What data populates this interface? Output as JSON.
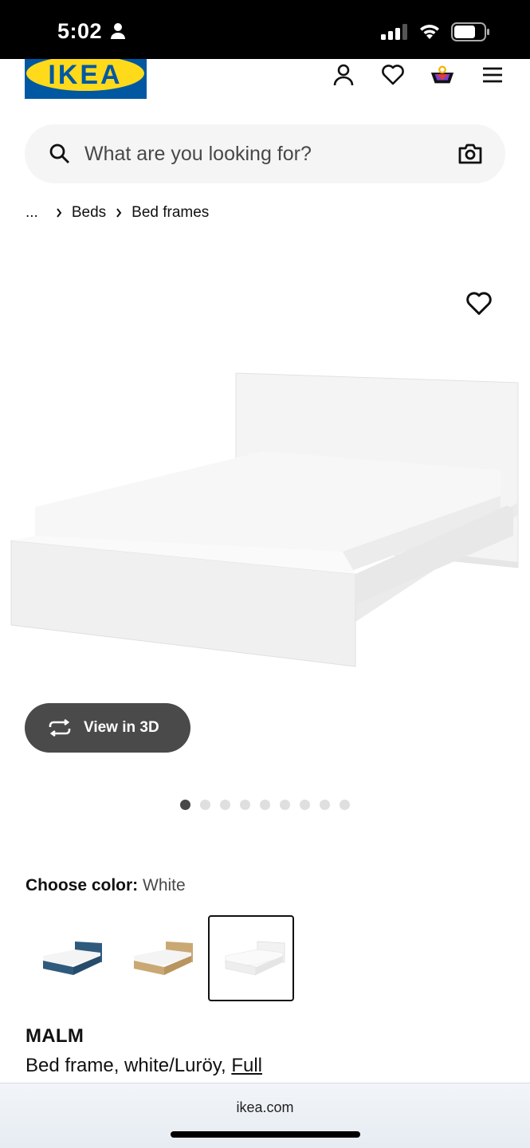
{
  "status_bar": {
    "time": "5:02"
  },
  "header": {
    "logo_text": "IKEA",
    "icons": [
      "user-icon",
      "heart-icon",
      "basket-icon",
      "menu-icon"
    ],
    "brand_colors": {
      "blue": "#0058a3",
      "yellow": "#ffda1a"
    }
  },
  "search": {
    "placeholder": "What are you looking for?"
  },
  "breadcrumb": {
    "ellipsis": "...",
    "items": [
      "Beds",
      "Bed frames"
    ]
  },
  "gallery": {
    "view_3d_label": "View in 3D",
    "total_images": 9,
    "active_index": 0
  },
  "color": {
    "label": "Choose color:",
    "selected": "White",
    "options": [
      {
        "name": "dark blue",
        "color": "#2f5a7e"
      },
      {
        "name": "oak veneer",
        "color": "#c9a874"
      },
      {
        "name": "white",
        "color": "#f2f2f2"
      }
    ],
    "selected_index": 2
  },
  "product": {
    "name": "MALM",
    "description": "Bed frame, white/Luröy, ",
    "size_link": "Full"
  },
  "browser": {
    "url": "ikea.com"
  }
}
